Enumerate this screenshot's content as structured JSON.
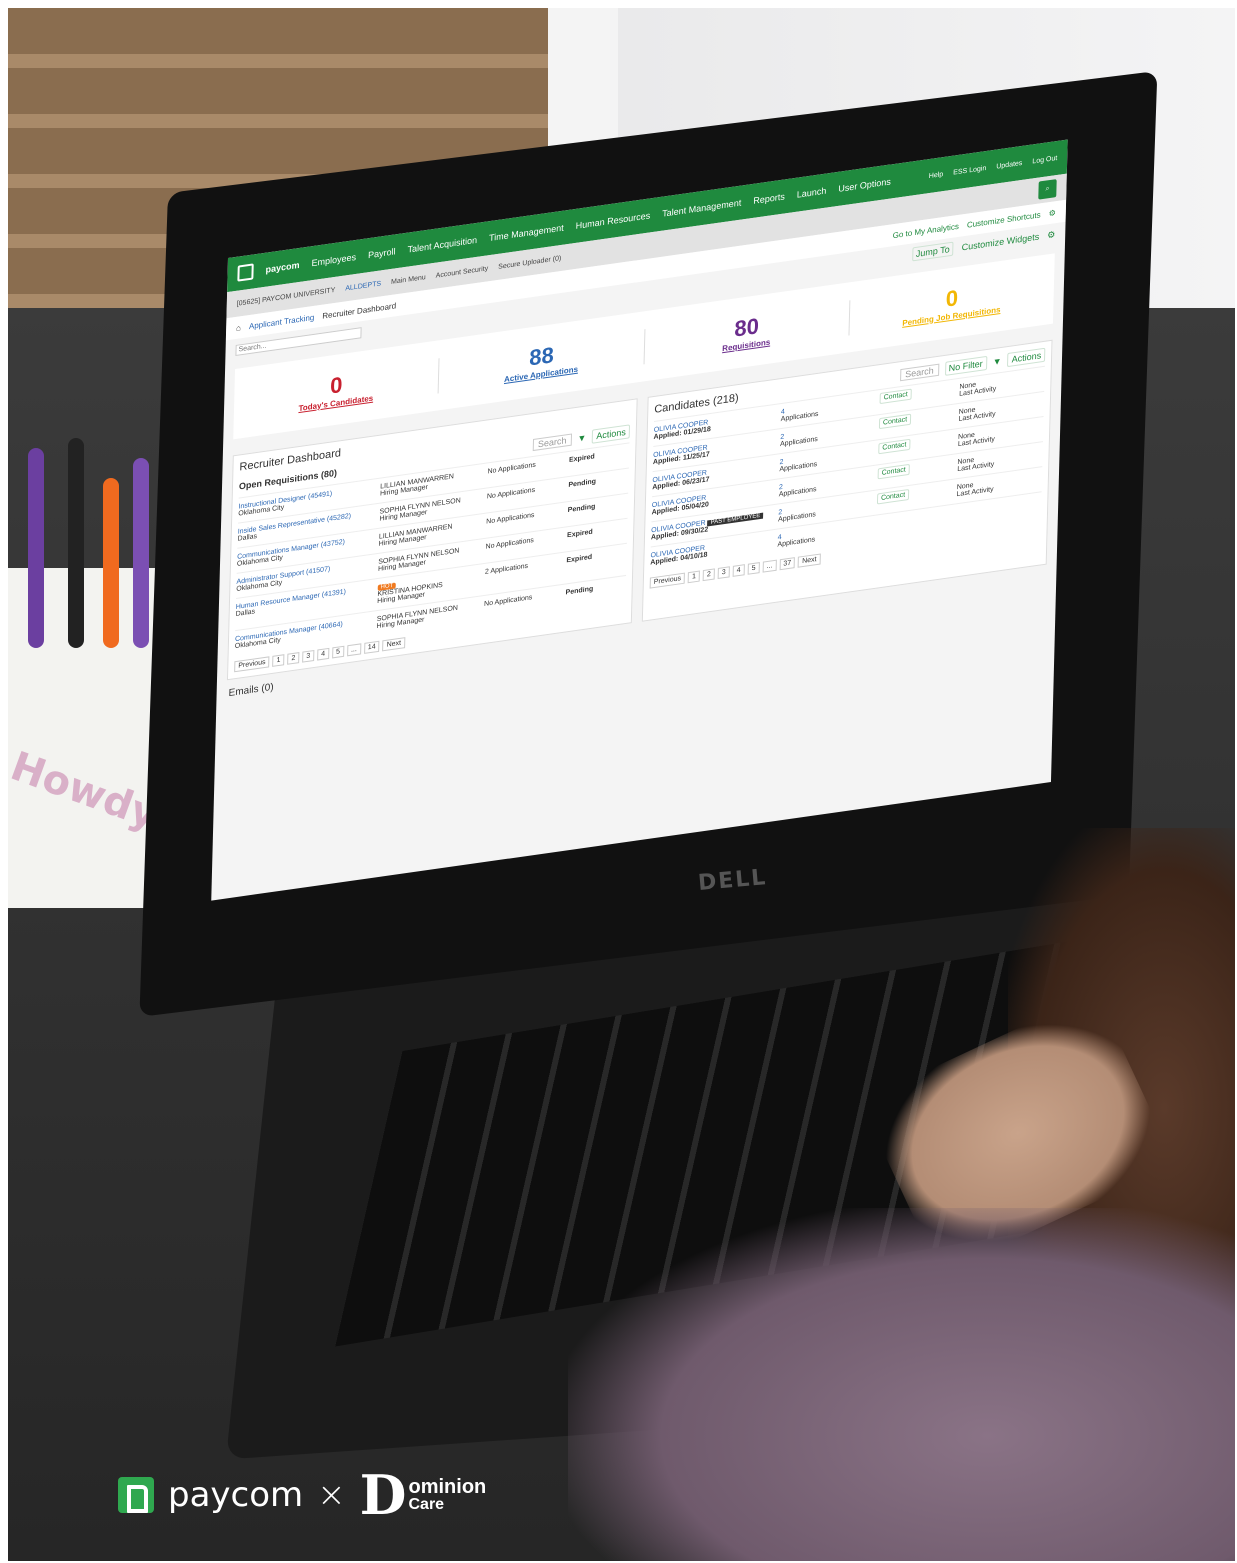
{
  "app": {
    "brand": "paycom",
    "nav": [
      "Employees",
      "Payroll",
      "Talent Acquisition",
      "Time Management",
      "Human Resources",
      "Talent Management",
      "Reports",
      "Launch",
      "User Options"
    ],
    "utility": [
      "Help",
      "ESS Login",
      "Updates",
      "Log Out"
    ],
    "subbar": [
      "[05625] PAYCOM UNIVERSITY",
      "ALLDEPTS",
      "Main Menu",
      "Account Security",
      "Secure Uploader (0)"
    ],
    "search_placeholder": "Search...",
    "links": {
      "analytics": "Go to My Analytics",
      "shortcuts": "Customize Shortcuts",
      "widgets": "Customize Widgets",
      "jump": "Jump To"
    },
    "breadcrumb": [
      "Applicant Tracking",
      "Recruiter Dashboard"
    ],
    "kpis": [
      {
        "value": "0",
        "label": "Today's Candidates",
        "color": "#c8202f"
      },
      {
        "value": "88",
        "label": "Active Applications",
        "color": "#2b67b4"
      },
      {
        "value": "80",
        "label": "Requisitions",
        "color": "#6a2c8c"
      },
      {
        "value": "0",
        "label": "Pending Job Requisitions",
        "color": "#f2b705"
      }
    ],
    "dashboard_title": "Recruiter Dashboard",
    "requisitions": {
      "title": "Open Requisitions (80)",
      "search": "Search",
      "actions": "Actions",
      "rows": [
        {
          "title": "Instructional Designer (45491)",
          "city": "Oklahoma City",
          "manager": "LILLIAN MANWARREN",
          "role": "Hiring Manager",
          "apps": "No Applications",
          "status": "Expired",
          "hot": ""
        },
        {
          "title": "Inside Sales Representative (45282)",
          "city": "Dallas",
          "manager": "SOPHIA FLYNN NELSON",
          "role": "Hiring Manager",
          "apps": "No Applications",
          "status": "Pending",
          "hot": ""
        },
        {
          "title": "Communications Manager (43752)",
          "city": "Oklahoma City",
          "manager": "LILLIAN MANWARREN",
          "role": "Hiring Manager",
          "apps": "No Applications",
          "status": "Pending",
          "hot": ""
        },
        {
          "title": "Administrator Support (41507)",
          "city": "Oklahoma City",
          "manager": "SOPHIA FLYNN NELSON",
          "role": "Hiring Manager",
          "apps": "No Applications",
          "status": "Expired",
          "hot": ""
        },
        {
          "title": "Human Resource Manager (41391)",
          "city": "Dallas",
          "manager": "KRISTINA HOPKINS",
          "role": "Hiring Manager",
          "apps": "2 Applications",
          "status": "Expired",
          "hot": "HOT"
        },
        {
          "title": "Communications Manager (40664)",
          "city": "Oklahoma City",
          "manager": "SOPHIA FLYNN NELSON",
          "role": "Hiring Manager",
          "apps": "No Applications",
          "status": "Pending",
          "hot": ""
        }
      ],
      "pager": [
        "Previous",
        "1",
        "2",
        "3",
        "4",
        "5",
        "...",
        "14",
        "Next"
      ]
    },
    "candidates": {
      "title": "Candidates (218)",
      "search": "Search",
      "filter": "No Filter",
      "actions": "Actions",
      "rows": [
        {
          "name": "OLIVIA COOPER",
          "applied": "Applied: 01/29/18",
          "count": "4",
          "label": "Applications",
          "contact": "Contact",
          "activity": "None",
          "activity_label": "Last Activity",
          "tag": ""
        },
        {
          "name": "OLIVIA COOPER",
          "applied": "Applied: 11/25/17",
          "count": "2",
          "label": "Applications",
          "contact": "Contact",
          "activity": "None",
          "activity_label": "Last Activity",
          "tag": ""
        },
        {
          "name": "OLIVIA COOPER",
          "applied": "Applied: 06/23/17",
          "count": "2",
          "label": "Applications",
          "contact": "Contact",
          "activity": "None",
          "activity_label": "Last Activity",
          "tag": ""
        },
        {
          "name": "OLIVIA COOPER",
          "applied": "Applied: 05/04/20",
          "count": "2",
          "label": "Applications",
          "contact": "Contact",
          "activity": "None",
          "activity_label": "Last Activity",
          "tag": ""
        },
        {
          "name": "OLIVIA COOPER",
          "applied": "Applied: 09/30/22",
          "count": "2",
          "label": "Applications",
          "contact": "Contact",
          "activity": "None",
          "activity_label": "Last Activity",
          "tag": "PAST EMPLOYEE"
        },
        {
          "name": "OLIVIA COOPER",
          "applied": "Applied: 04/10/18",
          "count": "4",
          "label": "Applications",
          "contact": "",
          "activity": "",
          "activity_label": "",
          "tag": ""
        }
      ],
      "pager": [
        "Previous",
        "1",
        "2",
        "3",
        "4",
        "5",
        "...",
        "37",
        "Next"
      ]
    },
    "emails": "Emails (0)"
  },
  "laptop_brand": "DELL",
  "caddy_text": "Howdy",
  "footer": {
    "paycom": "paycom",
    "dominion_1": "ominion",
    "dominion_2": "Care"
  },
  "colors": {
    "paycom_green": "#1f8a3e",
    "logo_green": "#2fa84f"
  }
}
